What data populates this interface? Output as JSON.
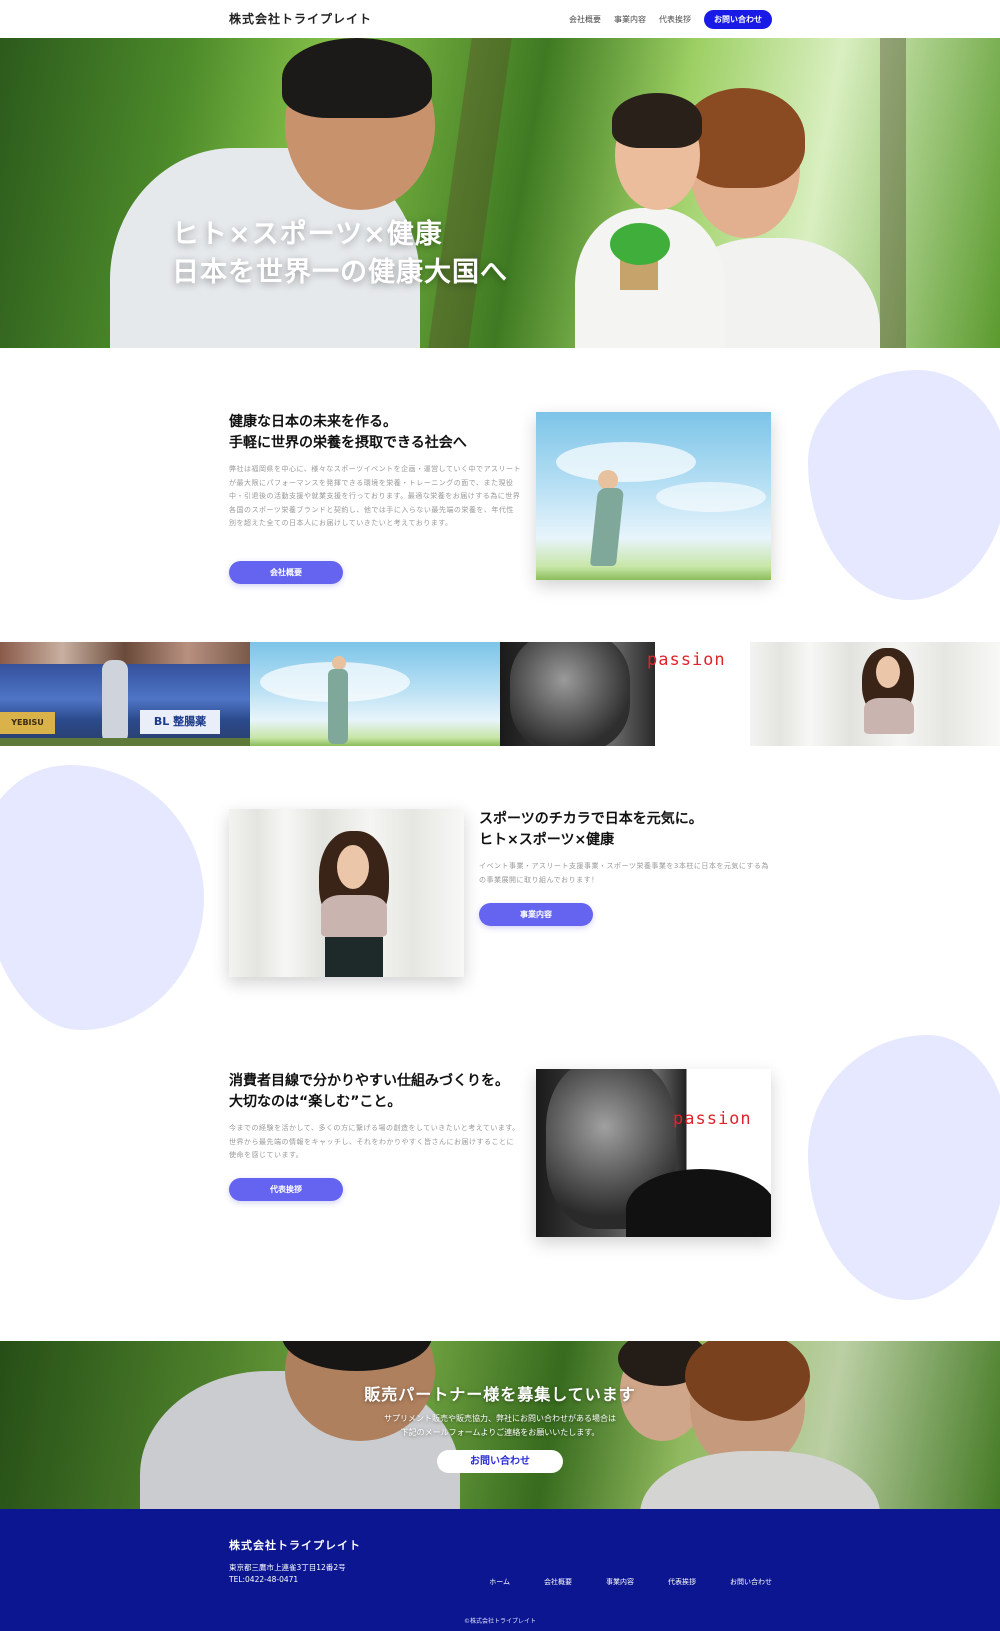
{
  "header": {
    "logo": "株式会社トライプレイト",
    "nav": [
      "会社概要",
      "事業内容",
      "代表挨拶"
    ],
    "cta": "お問い合わせ"
  },
  "hero": {
    "line1": "ヒト×スポーツ×健康",
    "line2": "日本を世界一の健康大国へ"
  },
  "section1": {
    "title_line1": "健康な日本の未来を作る。",
    "title_line2": "手軽に世界の栄養を摂取できる社会へ",
    "body": "弊社は福岡県を中心に、様々なスポーツイベントを企画・運営していく中でアスリートが最大限にパフォーマンスを発揮できる環境を栄養・トレーニングの面で、また現役中・引退後の活動支援や就業支援を行っております。最適な栄養をお届けする為に世界各国のスポーツ栄養ブランドと契約し、他では手に入らない最先端の栄養を、年代性別を超えた全ての日本人にお届けしていきたいと考えております。",
    "button": "会社概要"
  },
  "section2": {
    "title_line1": "スポーツのチカラで日本を元気に。",
    "title_line2": "ヒト×スポーツ×健康",
    "body": "イベント事業・アスリート支援事業・スポーツ栄養事業を3本柱に日本を元気にする為の事業展開に取り組んでおります！",
    "button": "事業内容"
  },
  "section3": {
    "title_line1": "消費者目線で分かりやすい仕組みづくりを。",
    "title_line2": "大切なのは“楽しむ”こと。",
    "body": "今までの経験を活かして、多くの方に繋げる場の創造をしていきたいと考えています。世界から最先端の情報をキャッチし、それをわかりやすく皆さんにお届けすることに使命を感じています。",
    "button": "代表挨拶"
  },
  "photo_text": {
    "passion": "passion",
    "banner1": "YEBISU",
    "banner2": "BL 整腸薬"
  },
  "partner": {
    "title": "販売パートナー様を募集しています",
    "text_line1": "サプリメント販売や販売協力、弊社にお問い合わせがある場合は",
    "text_line2": "下記のメールフォームよりご連絡をお願いいたします。",
    "button": "お問い合わせ"
  },
  "footer": {
    "company": "株式会社トライプレイト",
    "address": "東京都三鷹市上連雀3丁目12番2号",
    "tel": "TEL:0422-48-0471",
    "nav": [
      "ホーム",
      "会社概要",
      "事業内容",
      "代表挨拶",
      "お問い合わせ"
    ],
    "copyright": "©株式会社トライプレイト"
  },
  "colors": {
    "accent": "#1a1ae6",
    "button": "#6464f0",
    "blob": "#e6e8ff",
    "footer": "#0b1690",
    "passion": "#e0242a"
  }
}
